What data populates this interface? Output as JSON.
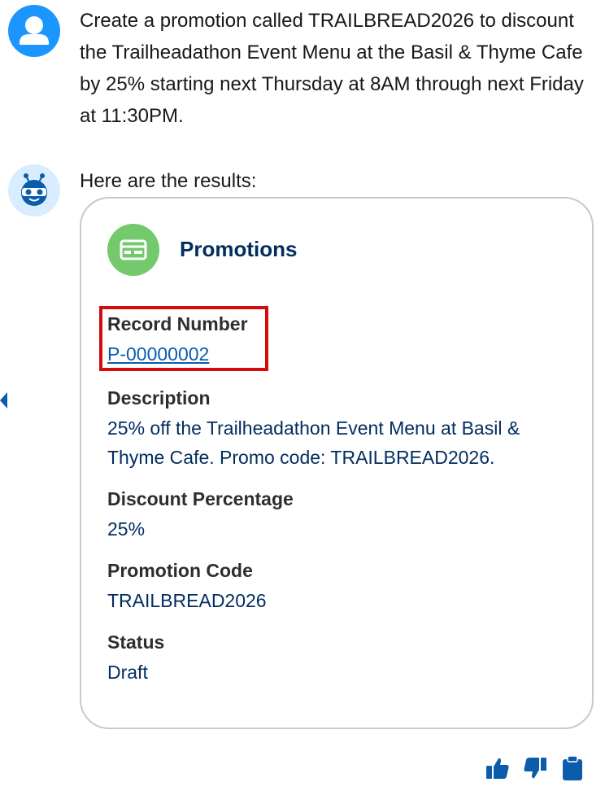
{
  "conversation": {
    "user_message": "Create a promotion called TRAILBREAD2026 to discount the Trailheadathon Event Menu at the Basil & Thyme Cafe by 25% starting next Thursday at 8AM through next Friday at 11:30PM.",
    "bot_intro": "Here are the results:"
  },
  "card": {
    "title": "Promotions",
    "icon": "promotions-card-icon",
    "accent_color": "#73c96b",
    "fields": [
      {
        "label": "Record Number",
        "value": "P-00000002"
      },
      {
        "label": "Description",
        "value": "25% off the Trailheadathon Event Menu at Basil & Thyme Cafe. Promo code: TRAILBREAD2026."
      },
      {
        "label": "Discount Percentage",
        "value": "25%"
      },
      {
        "label": "Promotion Code",
        "value": "TRAILBREAD2026"
      },
      {
        "label": "Status",
        "value": "Draft"
      }
    ]
  },
  "actions": {
    "icons": [
      "thumbs-up-icon",
      "thumbs-down-icon",
      "clipboard-icon"
    ]
  },
  "colors": {
    "user_avatar": "#1b96ff",
    "bot_avatar_bg": "#d8edff",
    "link": "#0b5cab",
    "value_text": "#032d60",
    "highlight": "#d40c0c"
  }
}
